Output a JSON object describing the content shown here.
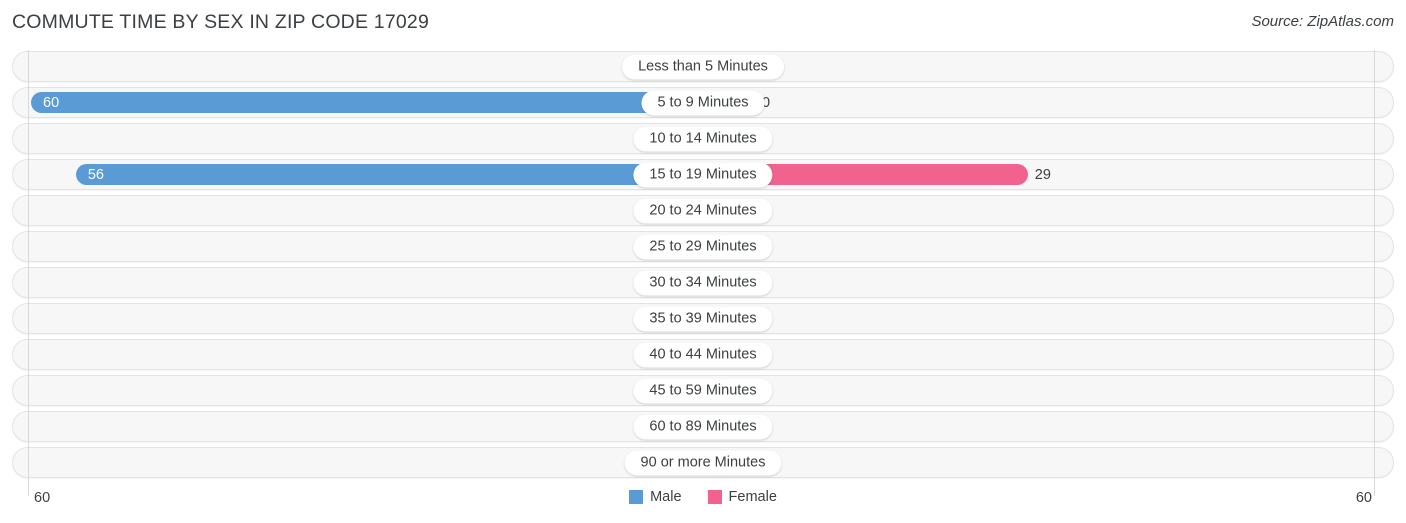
{
  "header": {
    "title": "COMMUTE TIME BY SEX IN ZIP CODE 17029",
    "source": "Source: ZipAtlas.com"
  },
  "colors": {
    "male": "#5B9BD5",
    "female": "#F2628F",
    "male_zero": "#AEC9EC",
    "female_zero": "#F7AFC6",
    "track": "#f7f7f7",
    "text": "#3c4043"
  },
  "axis": {
    "left_label": "60",
    "right_label": "60",
    "max": 60
  },
  "legend": [
    {
      "label": "Male",
      "color": "#5B9BD5",
      "name": "legend-male"
    },
    {
      "label": "Female",
      "color": "#F2628F",
      "name": "legend-female"
    }
  ],
  "chart_data": {
    "type": "bar",
    "title": "COMMUTE TIME BY SEX IN ZIP CODE 17029",
    "subtitle": "Source: ZipAtlas.com",
    "orientation": "horizontal-diverging",
    "xlabel": "",
    "ylabel": "",
    "xlim": [
      0,
      60
    ],
    "grid": true,
    "legend_position": "bottom-center",
    "categories": [
      "Less than 5 Minutes",
      "5 to 9 Minutes",
      "10 to 14 Minutes",
      "15 to 19 Minutes",
      "20 to 24 Minutes",
      "25 to 29 Minutes",
      "30 to 34 Minutes",
      "35 to 39 Minutes",
      "40 to 44 Minutes",
      "45 to 59 Minutes",
      "60 to 89 Minutes",
      "90 or more Minutes"
    ],
    "series": [
      {
        "name": "Male",
        "color": "#5B9BD5",
        "values": [
          0,
          60,
          0,
          56,
          0,
          0,
          0,
          0,
          0,
          0,
          0,
          0
        ]
      },
      {
        "name": "Female",
        "color": "#F2628F",
        "values": [
          0,
          0,
          0,
          29,
          0,
          0,
          0,
          0,
          0,
          0,
          0,
          0
        ]
      }
    ]
  },
  "rows": [
    {
      "label": "Less than 5 Minutes",
      "male": "0",
      "female": "0"
    },
    {
      "label": "5 to 9 Minutes",
      "male": "60",
      "female": "0"
    },
    {
      "label": "10 to 14 Minutes",
      "male": "0",
      "female": "0"
    },
    {
      "label": "15 to 19 Minutes",
      "male": "56",
      "female": "29"
    },
    {
      "label": "20 to 24 Minutes",
      "male": "0",
      "female": "0"
    },
    {
      "label": "25 to 29 Minutes",
      "male": "0",
      "female": "0"
    },
    {
      "label": "30 to 34 Minutes",
      "male": "0",
      "female": "0"
    },
    {
      "label": "35 to 39 Minutes",
      "male": "0",
      "female": "0"
    },
    {
      "label": "40 to 44 Minutes",
      "male": "0",
      "female": "0"
    },
    {
      "label": "45 to 59 Minutes",
      "male": "0",
      "female": "0"
    },
    {
      "label": "60 to 89 Minutes",
      "male": "0",
      "female": "0"
    },
    {
      "label": "90 or more Minutes",
      "male": "0",
      "female": "0"
    }
  ]
}
